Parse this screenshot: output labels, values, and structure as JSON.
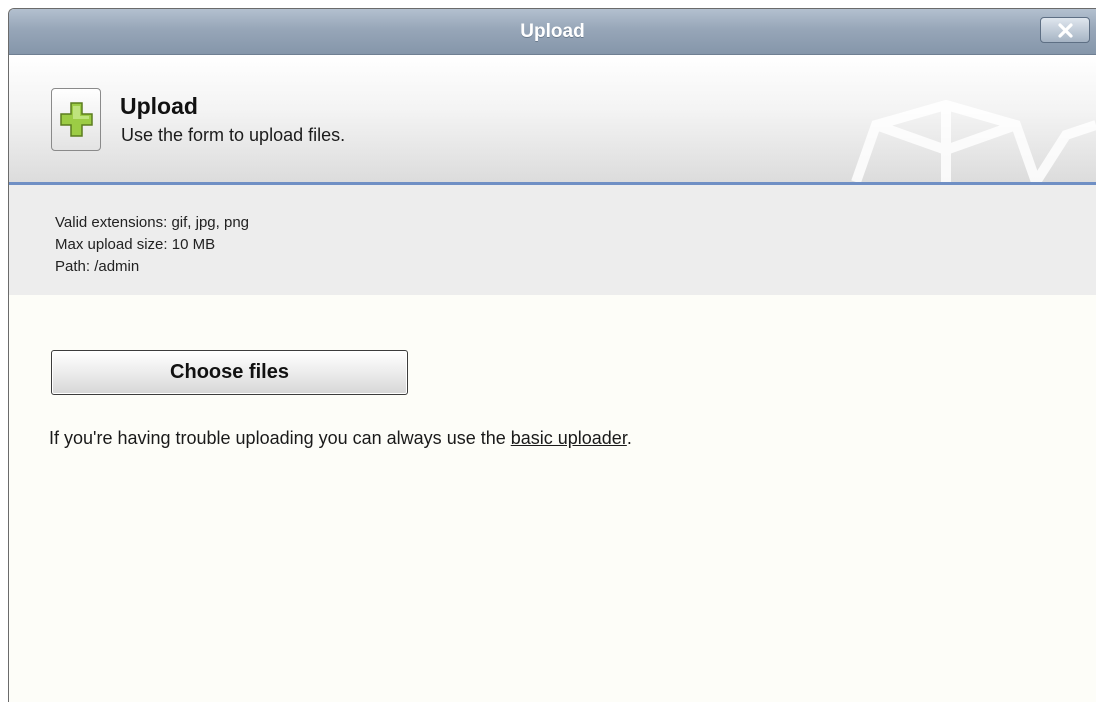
{
  "window": {
    "title": "Upload",
    "close_icon": "close-icon"
  },
  "header": {
    "icon": "add-plus-icon",
    "title": "Upload",
    "subtitle": "Use the form to upload files."
  },
  "info": {
    "extensions": "Valid extensions: gif, jpg, png",
    "max_size": "Max upload size: 10 MB",
    "path": "Path: /admin"
  },
  "main": {
    "choose_button_label": "Choose files",
    "help_text_before": "If you're having trouble uploading you can always use the ",
    "help_link_text": "basic uploader",
    "help_text_after": "."
  },
  "colors": {
    "titlebar": "#97a6b8",
    "header_accent": "#6f8fc4",
    "plus_icon": "#8fc43a"
  }
}
